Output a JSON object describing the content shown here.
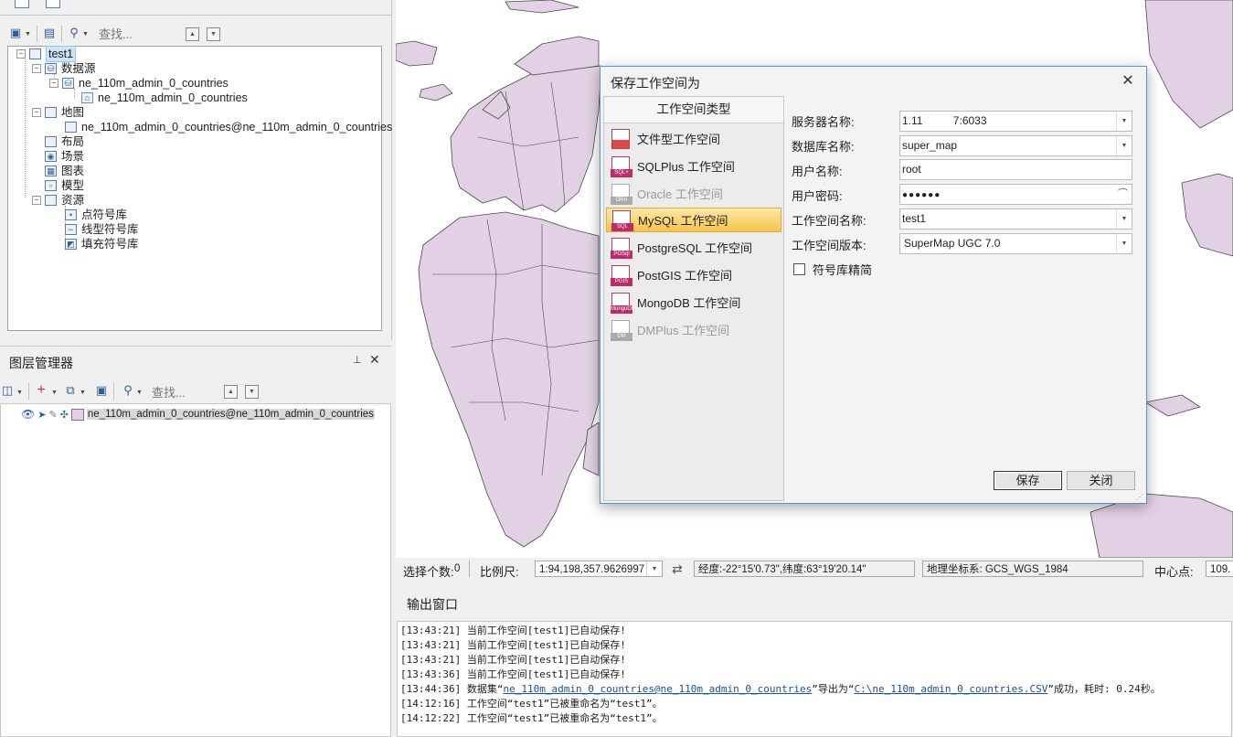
{
  "workspace_panel": {
    "search_placeholder": "查找...",
    "tree": [
      {
        "label": "test1",
        "selected": true
      },
      {
        "label": "数据源"
      },
      {
        "label": "ne_110m_admin_0_countries"
      },
      {
        "label": "ne_110m_admin_0_countries"
      },
      {
        "label": "地图"
      },
      {
        "label": "ne_110m_admin_0_countries@ne_110m_admin_0_countries"
      },
      {
        "label": "布局"
      },
      {
        "label": "场景"
      },
      {
        "label": "图表"
      },
      {
        "label": "模型"
      },
      {
        "label": "资源"
      },
      {
        "label": "点符号库"
      },
      {
        "label": "线型符号库"
      },
      {
        "label": "填充符号库"
      }
    ]
  },
  "layer_manager": {
    "title": "图层管理器",
    "search_placeholder": "查找...",
    "layers": [
      {
        "label": "ne_110m_admin_0_countries@ne_110m_admin_0_countries"
      }
    ]
  },
  "statusbar": {
    "select_count_label": "选择个数:",
    "select_count": "0",
    "scale_label": "比例尺:",
    "scale_value": "1:94,198,357.9626997",
    "coords": "经度:-22°15'0.73\",纬度:63°19'20.14\"",
    "crs": "地理坐标系: GCS_WGS_1984",
    "center_label": "中心点:",
    "center_value": "109."
  },
  "output": {
    "title": "输出窗口",
    "lines": [
      {
        "text": "[13:43:21] 当前工作空间[test1]已自动保存!"
      },
      {
        "text": "[13:43:21] 当前工作空间[test1]已自动保存!"
      },
      {
        "text": "[13:43:21] 当前工作空间[test1]已自动保存!"
      },
      {
        "text": "[13:43:36] 当前工作空间[test1]已自动保存!"
      },
      {
        "pre": "[13:44:36] 数据集“",
        "link1": "ne_110m_admin_0_countries@ne_110m_admin_0_countries",
        "mid": "”导出为“",
        "link2": "C:\\ne_110m_admin_0_countries.CSV",
        "post": "”成功，耗时: 0.24秒。"
      },
      {
        "text": "[14:12:16] 工作空间“test1”已被重命名为“test1”。"
      },
      {
        "text": "[14:12:22] 工作空间“test1”已被重命名为“test1”。"
      }
    ]
  },
  "dialog": {
    "title": "保存工作空间为",
    "list_header": "工作空间类型",
    "types": [
      {
        "label": "文件型工作空间",
        "badge": "",
        "active": false,
        "disabled": false
      },
      {
        "label": "SQLPlus 工作空间",
        "badge": "SQL+",
        "active": false,
        "disabled": false
      },
      {
        "label": "Oracle 工作空间",
        "badge": "ORA",
        "active": false,
        "disabled": true
      },
      {
        "label": "MySQL 工作空间",
        "badge": "SQL",
        "active": true,
        "disabled": false
      },
      {
        "label": "PostgreSQL 工作空间",
        "badge": "PGSql",
        "active": false,
        "disabled": false
      },
      {
        "label": "PostGIS 工作空间",
        "badge": "PGIS",
        "active": false,
        "disabled": false
      },
      {
        "label": "MongoDB 工作空间",
        "badge": "MongoDB",
        "active": false,
        "disabled": false
      },
      {
        "label": "DMPlus 工作空间",
        "badge": "DM",
        "active": false,
        "disabled": true
      }
    ],
    "fields": {
      "server_label": "服务器名称:",
      "server_value": "1.11          7:6033",
      "db_label": "数据库名称:",
      "db_value": "super_map",
      "user_label": "用户名称:",
      "user_value": "root",
      "password_label": "用户密码:",
      "password_value": "●●●●●●",
      "ws_name_label": "工作空间名称:",
      "ws_name_value": "test1",
      "ws_version_label": "工作空间版本:",
      "ws_version_value": "SuperMap UGC 7.0",
      "symbol_simplify_label": "符号库精简",
      "symbol_simplify_checked": false
    },
    "save_label": "保存",
    "close_label": "关闭"
  },
  "colors": {
    "map_land": "#e2d1e4",
    "map_border": "#4a4a4a",
    "accent": "#5b8fd4",
    "active_item": "#f7c54a"
  }
}
